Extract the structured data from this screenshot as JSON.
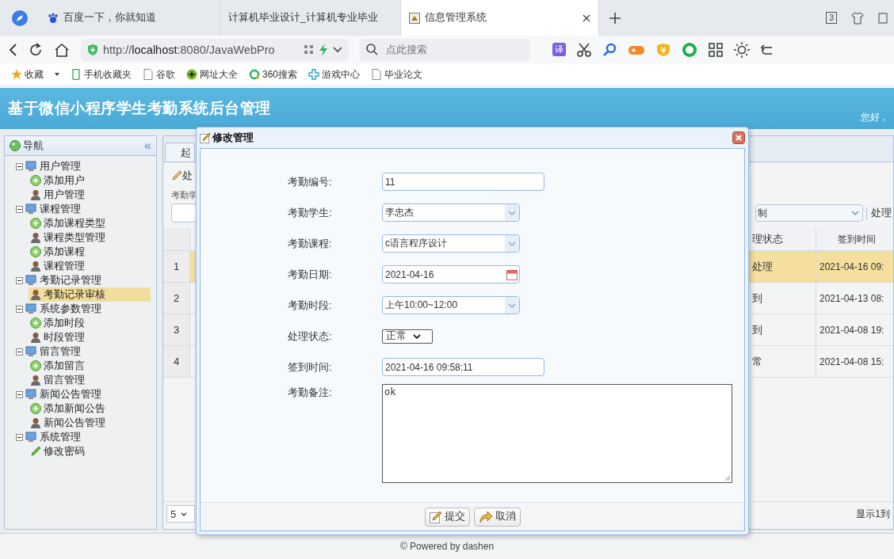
{
  "browser": {
    "tabs": [
      {
        "label": "百度一下，你就知道",
        "selected": false
      },
      {
        "label": "计算机毕业设计_计算机专业毕业",
        "selected": false
      },
      {
        "label": "信息管理系统",
        "selected": true
      }
    ],
    "tab_count": "3",
    "url_prefix": "http://",
    "url_host": "localhost",
    "url_rest": ":8080/JavaWebPro",
    "search": {
      "placeholder": "点此搜索"
    },
    "translate_label": "译",
    "bookmarks": [
      {
        "label": "收藏",
        "kind": "star"
      },
      {
        "label": "手机收藏夹",
        "kind": "phone"
      },
      {
        "label": "谷歌",
        "kind": "doc"
      },
      {
        "label": "网址大全",
        "kind": "plus"
      },
      {
        "label": "360搜索",
        "kind": "ring"
      },
      {
        "label": "游戏中心",
        "kind": "game"
      },
      {
        "label": "毕业论文",
        "kind": "doc"
      }
    ]
  },
  "app": {
    "title": "基于微信小程序学生考勤系统后台管理",
    "greeting": "您好，"
  },
  "sidebar": {
    "title": "导航",
    "collapse": "«",
    "items": [
      {
        "label": "用户管理",
        "expanded": true,
        "children": [
          {
            "label": "添加用户",
            "kind": "add",
            "selected": false
          },
          {
            "label": "用户管理",
            "kind": "manage",
            "selected": false
          }
        ]
      },
      {
        "label": "课程管理",
        "expanded": true,
        "children": [
          {
            "label": "添加课程类型",
            "kind": "add",
            "selected": false
          },
          {
            "label": "课程类型管理",
            "kind": "manage",
            "selected": false
          },
          {
            "label": "添加课程",
            "kind": "add",
            "selected": false
          },
          {
            "label": "课程管理",
            "kind": "manage",
            "selected": false
          }
        ]
      },
      {
        "label": "考勤记录管理",
        "expanded": true,
        "children": [
          {
            "label": "考勤记录审核",
            "kind": "manage",
            "selected": true
          }
        ]
      },
      {
        "label": "系统参数管理",
        "expanded": true,
        "children": [
          {
            "label": "添加时段",
            "kind": "add",
            "selected": false
          },
          {
            "label": "时段管理",
            "kind": "manage",
            "selected": false
          }
        ]
      },
      {
        "label": "留言管理",
        "expanded": true,
        "children": [
          {
            "label": "添加留言",
            "kind": "add",
            "selected": false
          },
          {
            "label": "留言管理",
            "kind": "manage",
            "selected": false
          }
        ]
      },
      {
        "label": "新闻公告管理",
        "expanded": true,
        "children": [
          {
            "label": "添加新闻公告",
            "kind": "add",
            "selected": false
          },
          {
            "label": "新闻公告管理",
            "kind": "manage",
            "selected": false
          }
        ]
      },
      {
        "label": "系统管理",
        "expanded": true,
        "children": [
          {
            "label": "修改密码",
            "kind": "password",
            "selected": false
          }
        ]
      }
    ]
  },
  "main": {
    "tab_label": "起",
    "toolbar_label": "处",
    "search_label": "考勤学",
    "filter_value": "制",
    "filter_label": "处理",
    "columns": [
      "理状态",
      "签到时间"
    ],
    "rows": [
      {
        "number": "1",
        "status": "处理",
        "time": "2021-04-16 09:",
        "selected": true
      },
      {
        "number": "2",
        "status": "到",
        "time": "2021-04-13 08:",
        "selected": false
      },
      {
        "number": "3",
        "status": "到",
        "time": "2021-04-08 19:",
        "selected": false
      },
      {
        "number": "4",
        "status": "常",
        "time": "2021-04-08 15:",
        "selected": false
      }
    ],
    "page_size": "5",
    "page_info": "显示1到"
  },
  "dialog": {
    "title": "修改管理",
    "fields": [
      {
        "label": "考勤编号:",
        "kind": "text",
        "value": "11"
      },
      {
        "label": "考勤学生:",
        "kind": "combo",
        "value": "李忠杰"
      },
      {
        "label": "考勤课程:",
        "kind": "combo",
        "value": "c语言程序设计"
      },
      {
        "label": "考勤日期:",
        "kind": "date",
        "value": "2021-04-16"
      },
      {
        "label": "考勤时段:",
        "kind": "combo",
        "value": "上午10:00~12:00"
      },
      {
        "label": "处理状态:",
        "kind": "select",
        "value": "正常"
      },
      {
        "label": "签到时间:",
        "kind": "text",
        "value": "2021-04-16 09:58:11"
      },
      {
        "label": "考勤备注:",
        "kind": "textarea",
        "value": "ok"
      }
    ],
    "buttons": [
      {
        "label": "提交",
        "kind": "submit"
      },
      {
        "label": "取消",
        "kind": "cancel"
      }
    ]
  },
  "footer": "© Powered by dashen"
}
